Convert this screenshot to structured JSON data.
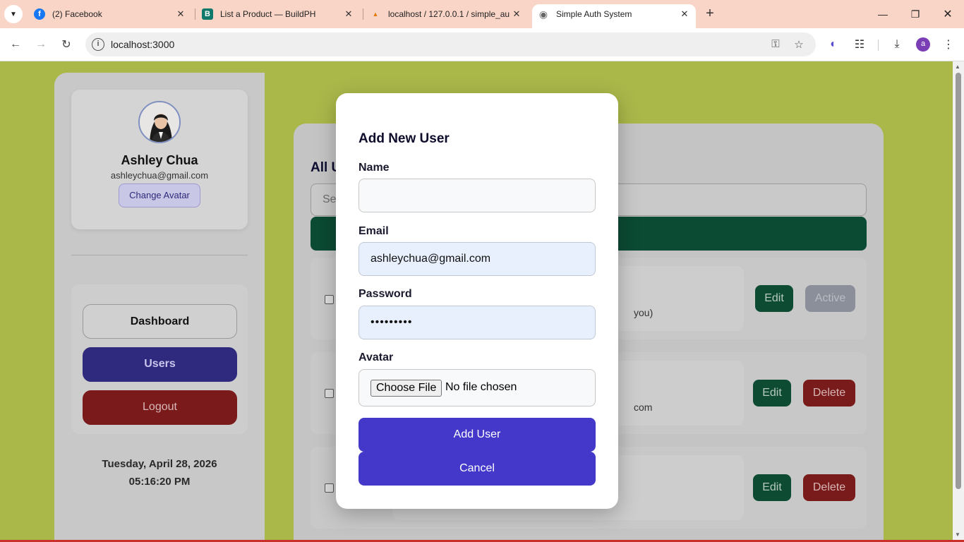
{
  "browser": {
    "tabs": [
      {
        "title": "(2) Facebook",
        "icon": "facebook-icon"
      },
      {
        "title": "List a Product — BuildPH",
        "icon": "buildph-icon",
        "badge": "B"
      },
      {
        "title": "localhost / 127.0.0.1 / simple_au",
        "icon": "phpmyadmin-icon"
      },
      {
        "title": "Simple Auth System",
        "icon": "globe-icon",
        "active": true
      }
    ],
    "url": "localhost:3000",
    "profile_initial": "a"
  },
  "sidebar": {
    "user_name": "Ashley Chua",
    "user_email": "ashleychua@gmail.com",
    "change_avatar_label": "Change Avatar",
    "nav": {
      "dashboard": "Dashboard",
      "users": "Users",
      "logout": "Logout"
    },
    "date": "Tuesday, April 28, 2026",
    "time": "05:16:20 PM"
  },
  "main": {
    "title_partial": "All U",
    "search_partial": "Se",
    "rows": [
      {
        "text_partial": "you)",
        "edit_label": "Edit",
        "status_label": "Active"
      },
      {
        "text_partial": "com",
        "edit_label": "Edit",
        "delete_label": "Delete"
      },
      {
        "edit_label": "Edit",
        "delete_label": "Delete"
      }
    ]
  },
  "modal": {
    "title": "Add New User",
    "name_label": "Name",
    "name_value": "",
    "email_label": "Email",
    "email_value": "ashleychua@gmail.com",
    "password_label": "Password",
    "password_value": "•••••••••",
    "avatar_label": "Avatar",
    "choose_file_label": "Choose File",
    "file_status": "No file chosen",
    "submit_label": "Add User",
    "cancel_label": "Cancel"
  },
  "colors": {
    "primary": "#4338ca",
    "page_bg": "#aab84a",
    "tabstrip": "#f9d5c7"
  }
}
